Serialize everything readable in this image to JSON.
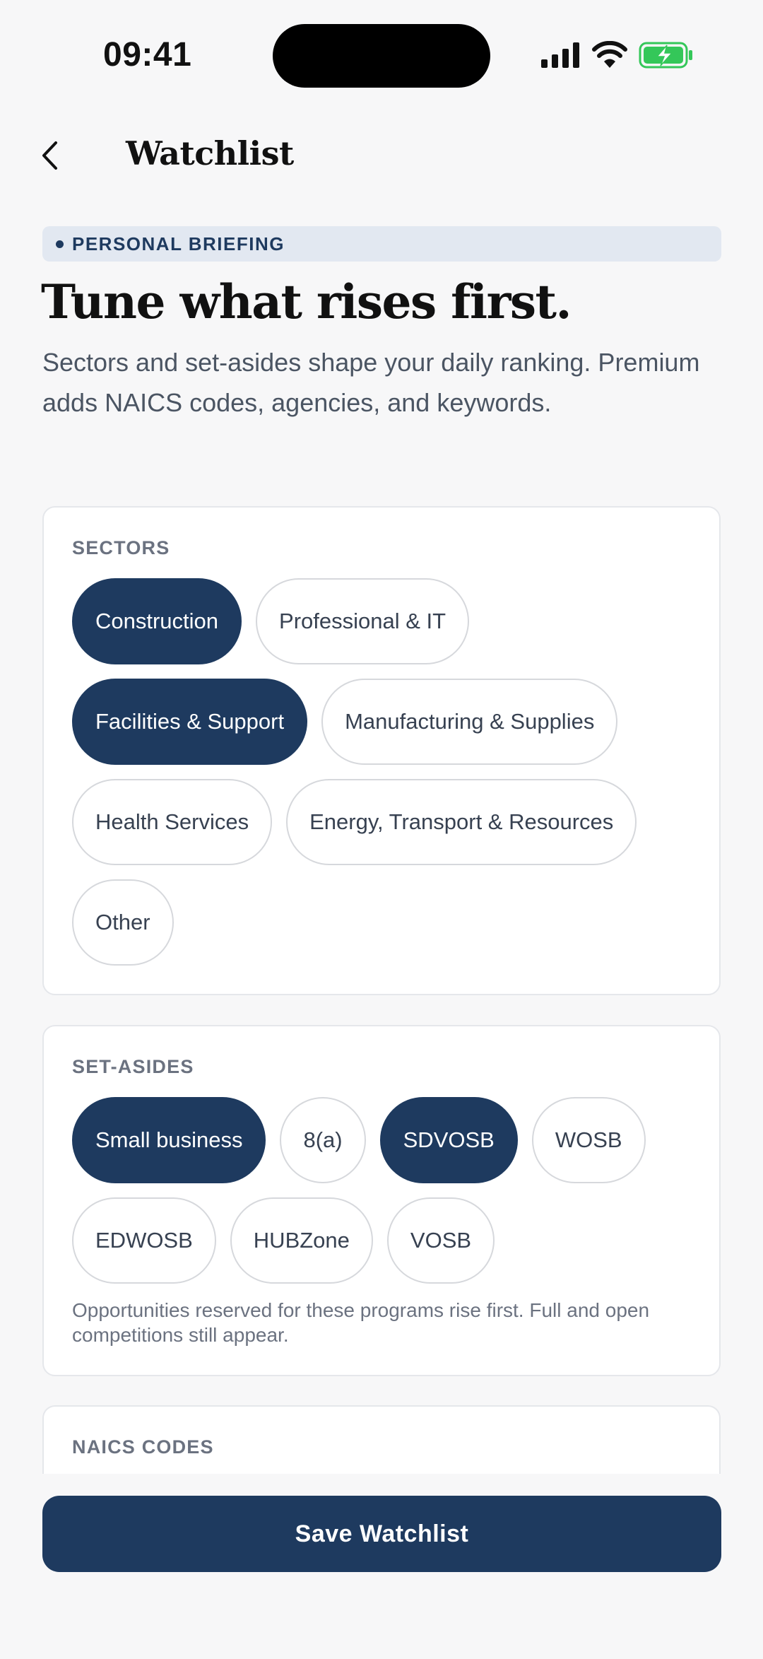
{
  "status_bar": {
    "time": "09:41"
  },
  "header": {
    "title": "Watchlist"
  },
  "eyebrow": "PERSONAL BRIEFING",
  "headline": "Tune what rises first.",
  "subtitle": "Sectors and set-asides shape your daily ranking. Premium adds NAICS codes, agencies, and keywords.",
  "sectors": {
    "label": "SECTORS",
    "chips": [
      {
        "label": "Construction",
        "selected": true
      },
      {
        "label": "Professional & IT",
        "selected": false
      },
      {
        "label": "Facilities & Support",
        "selected": true
      },
      {
        "label": "Manufacturing & Supplies",
        "selected": false
      },
      {
        "label": "Health Services",
        "selected": false
      },
      {
        "label": "Energy, Transport & Resources",
        "selected": false
      },
      {
        "label": "Other",
        "selected": false
      }
    ]
  },
  "set_asides": {
    "label": "SET-ASIDES",
    "chips": [
      {
        "label": "Small business",
        "selected": true
      },
      {
        "label": "8(a)",
        "selected": false
      },
      {
        "label": "SDVOSB",
        "selected": true
      },
      {
        "label": "WOSB",
        "selected": false
      },
      {
        "label": "EDWOSB",
        "selected": false
      },
      {
        "label": "HUBZone",
        "selected": false
      },
      {
        "label": "VOSB",
        "selected": false
      }
    ],
    "helper": "Opportunities reserved for these programs rise first. Full and open competitions still appear."
  },
  "naics": {
    "label": "NAICS CODES"
  },
  "save_button": "Save Watchlist",
  "colors": {
    "primary": "#1e3a5f",
    "eyebrow_bg": "#e2e8f1",
    "battery": "#34c759"
  }
}
